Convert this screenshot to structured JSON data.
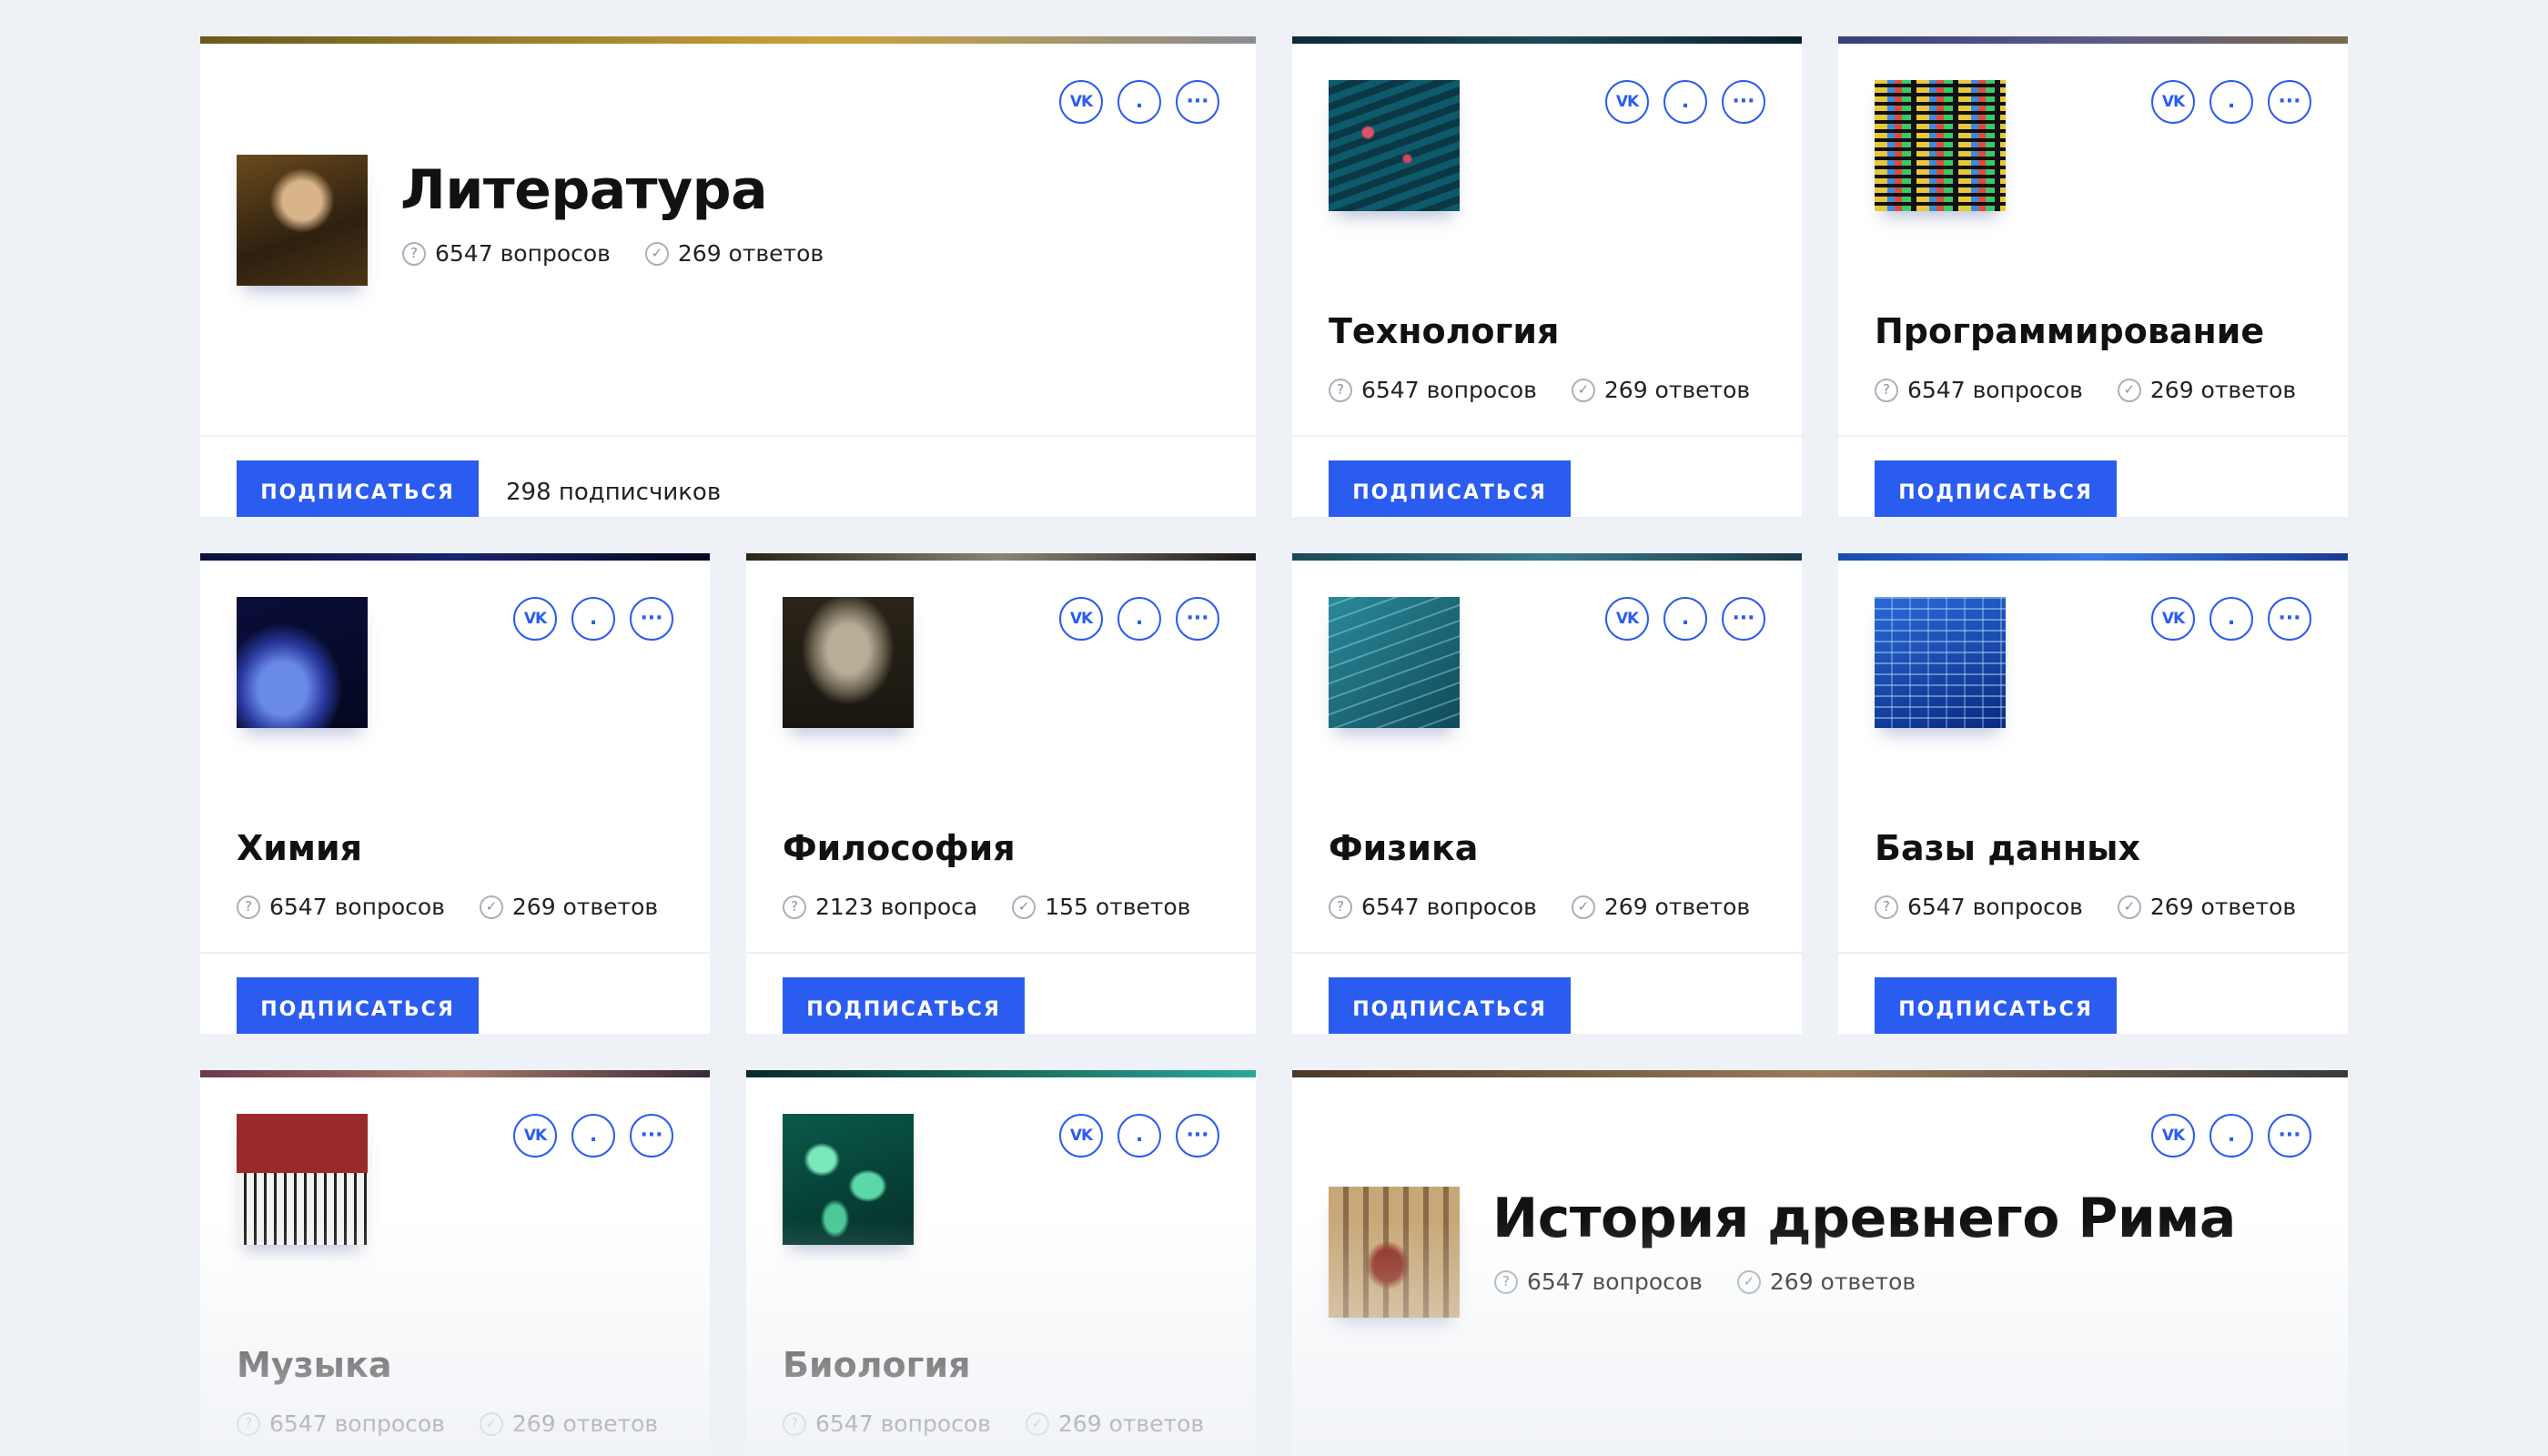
{
  "subscribe_label": "ПОДПИСАТЬСЯ",
  "share": {
    "vk_label": "VK",
    "dot_label": ".",
    "more_label": "···"
  },
  "accent_color": "#2b5cf0",
  "cards": [
    {
      "title": "Литература",
      "questions": "6547 вопросов",
      "answers": "269 ответов",
      "subscribers": "298 подписчиков"
    },
    {
      "title": "Технология",
      "questions": "6547 вопросов",
      "answers": "269 ответов"
    },
    {
      "title": "Программирование",
      "questions": "6547 вопросов",
      "answers": "269 ответов"
    },
    {
      "title": "Химия",
      "questions": "6547 вопросов",
      "answers": "269 ответов"
    },
    {
      "title": "Философия",
      "questions": "2123 вопроса",
      "answers": "155 ответов"
    },
    {
      "title": "Физика",
      "questions": "6547 вопросов",
      "answers": "269 ответов"
    },
    {
      "title": "Базы данных",
      "questions": "6547 вопросов",
      "answers": "269 ответов"
    },
    {
      "title": "Музыка",
      "questions": "6547 вопросов",
      "answers": "269 ответов"
    },
    {
      "title": "Биология",
      "questions": "6547 вопросов",
      "answers": "269 ответов"
    },
    {
      "title": "История древнего Рима",
      "questions": "6547 вопросов",
      "answers": "269 ответов"
    }
  ]
}
